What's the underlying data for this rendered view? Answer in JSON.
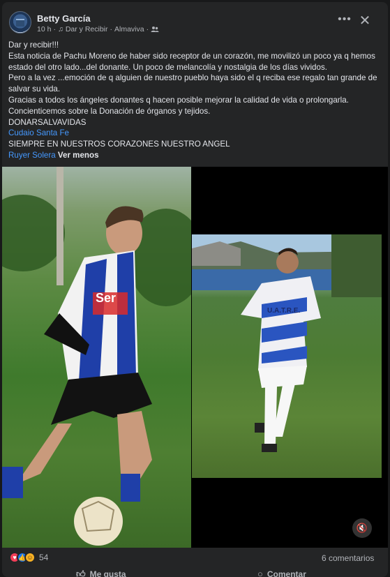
{
  "post": {
    "author": "Betty García",
    "time": "10 h",
    "category": "Dar y Recibir",
    "location": "Almaviva",
    "lines": [
      "Dar y recibir!!!",
      "Esta noticia de Pachu Moreno de haber sido receptor de un corazón, me movilizó un poco  ya q hemos estado del otro lado...del donante. Un poco de melancolía y nostalgia de los días vividos.",
      "Pero a la vez ...emoción de q alguien de nuestro pueblo haya sido el q reciba ese regalo tan grande de salvar su vida.",
      "Gracias a todos los ángeles donantes q hacen posible mejorar la calidad de vida o prolongarla.",
      "Concienticemos sobre la Donación de órganos y tejidos.",
      "DONARSALVAVIDAS"
    ],
    "tag1": "Cudaio Santa Fe",
    "closing": "SIEMPRE EN NUESTROS CORAZONES NUESTRO ANGEL",
    "tag2": "Ruyer Solera",
    "see_less": "Ver menos"
  },
  "media": {
    "left_photo": {
      "shirt_text": "Ser"
    },
    "right_photo": {
      "shirt_text": "U.A.T.R.E."
    }
  },
  "footer": {
    "reaction_count": "54",
    "comments": "6 comentarios",
    "like_label": "Me gusta",
    "comment_label": "Comentar"
  },
  "colors": {
    "card": "#242526",
    "link": "#4599ff",
    "text": "#e4e6eb",
    "muted": "#b0b3b8"
  }
}
